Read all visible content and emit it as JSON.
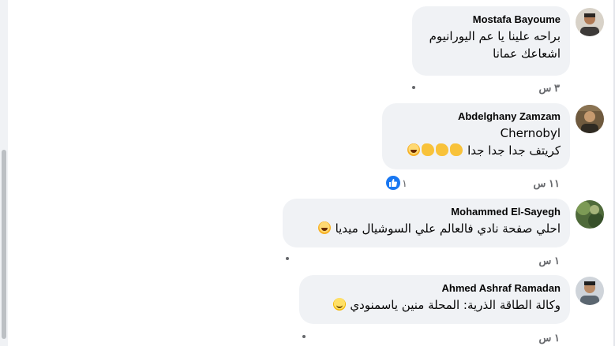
{
  "comments": [
    {
      "author": "Mostafa Bayoume",
      "lines": [
        "براحه علينا يا عم اليورانيوم",
        "اشعاعك عمانا"
      ],
      "time": "٣ س"
    },
    {
      "author": "Abdelghany Zamzam",
      "lines": [
        "Chernobyl",
        "كريتف جدا جدا جدا"
      ],
      "time": "١١ س",
      "reaction_count": "١"
    },
    {
      "author": "Mohammed El-Sayegh",
      "lines": [
        "احلي صفحة نادي فالعالم علي السوشيال ميديا"
      ],
      "time": "١ س"
    },
    {
      "author": "Ahmed Ashraf Ramadan",
      "lines": [
        "وكالة الطاقة الذرية: المحلة منين ياسمنودي"
      ],
      "time": "١ س"
    }
  ],
  "icons": {
    "laugh": "laughing-emoji-icon",
    "clap": "clapping-hands-emoji-icon",
    "smile": "smiling-emoji-icon",
    "like": "like-reaction-icon"
  },
  "colors": {
    "bubble": "#f0f2f5",
    "like_blue": "#1877f2",
    "meta_gray": "#65676b"
  }
}
